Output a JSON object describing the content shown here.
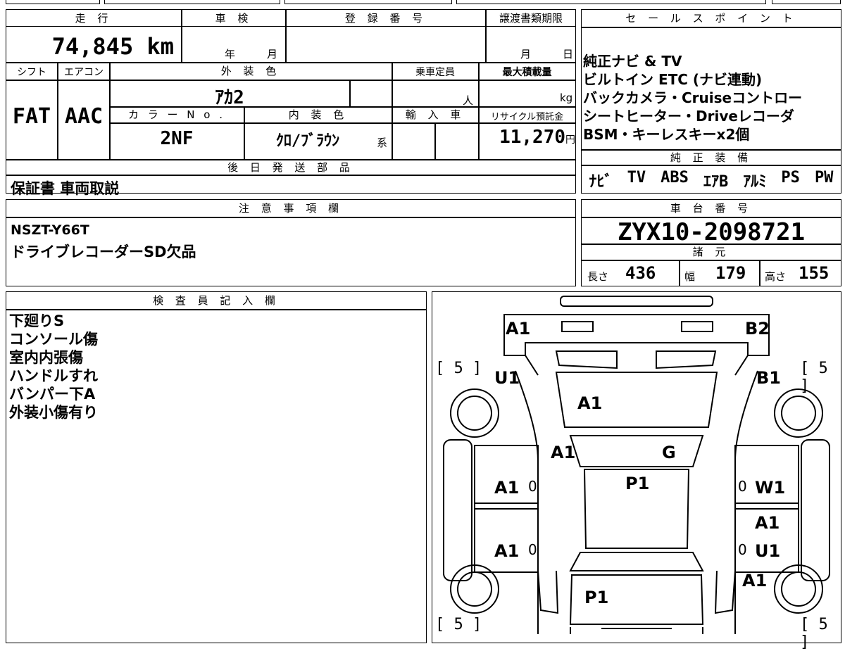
{
  "header": {
    "mileage_label": "走 行",
    "inspection_label": "車 検",
    "reg_label": "登 録 番 号",
    "transfer_label": "譲渡書類期限",
    "sales_label": "セ ー ル ス ポ イ ン ト"
  },
  "mileage": {
    "value": "74,845",
    "unit": "km"
  },
  "inspection": {
    "year": "年",
    "month": "月"
  },
  "transfer": {
    "month": "月",
    "day": "日"
  },
  "labels": {
    "shift": "シフト",
    "aircon": "エアコン",
    "exterior_color": "外 装 色",
    "capacity": "乗車定員",
    "max_load": "最大積載量",
    "color_no": "カ ラ ー N o .",
    "interior_color": "内 装 色",
    "import": "輸 入 車",
    "recycle": "リサイクル預託金",
    "later_parts": "後 日 発 送 部 品",
    "notes": "注 意 事 項 欄",
    "chassis": "車 台 番 号",
    "specs": "諸 元",
    "inspector": "検 査 員 記 入 欄",
    "genuine": "純 正 装 備"
  },
  "vehicle": {
    "shift": "FAT",
    "aircon": "AAC",
    "exterior_color": "ｱｶ2",
    "capacity_unit": "人",
    "max_load_unit": "kg",
    "color_no": "2NF",
    "interior_color": "ｸﾛ/ﾌﾞﾗｳﾝ",
    "interior_suffix": "系",
    "recycle_value": "11,270",
    "recycle_unit": "円"
  },
  "sales_points": [
    "純正ナビ & TV",
    "ビルトイン ETC (ナビ連動)",
    "バックカメラ・Cruiseコントロー",
    "シートヒーター・Driveレコーダ",
    "BSM・キーレスキーx2個"
  ],
  "later_parts": "保証書 車両取説",
  "genuine_equipment": [
    "ﾅﾋﾞ",
    "TV",
    "ABS",
    "ｴｱB",
    "ｱﾙﾐ",
    "PS",
    "PW"
  ],
  "notes": [
    "NSZT-Y66T",
    "ドライブレコーダーSD欠品"
  ],
  "chassis_no": "ZYX10-2098721",
  "dimensions": {
    "length_label": "長さ",
    "length": "436",
    "width_label": "幅",
    "width": "179",
    "height_label": "高さ",
    "height": "155"
  },
  "inspector_notes": [
    "下廻りS",
    "コンソール傷",
    "室内内張傷",
    "ハンドルすれ",
    "バンパー下A",
    "外装小傷有り"
  ],
  "diagram": {
    "bracket_value": "5",
    "marks": {
      "front_left": "A1",
      "front_right": "B2",
      "left_fender": "U1",
      "right_fender": "B1",
      "hood": "A1",
      "windshield_left": "A1",
      "windshield_right": "G",
      "roof": "P1",
      "left_front_door": "A1",
      "right_front_door": "W1",
      "right_rear_door_upper": "A1",
      "left_rear_door": "A1",
      "right_rear_door": "U1",
      "right_rear_quarter": "A1",
      "trunk": "P1",
      "zero_1": "0",
      "zero_2": "0",
      "zero_3": "0",
      "zero_4": "0"
    }
  }
}
